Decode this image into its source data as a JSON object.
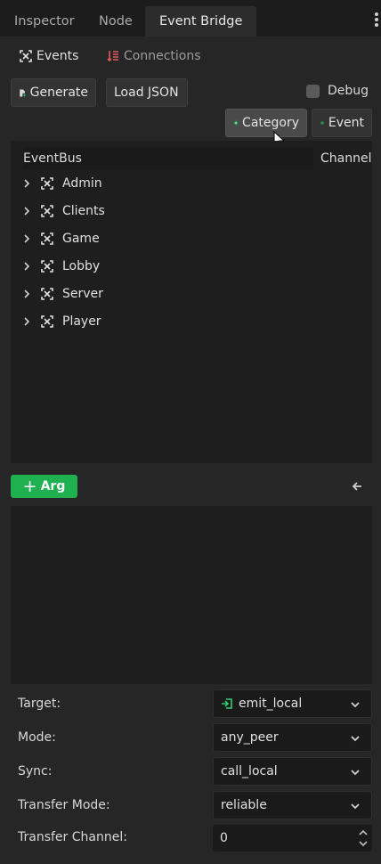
{
  "tabs": [
    {
      "label": "Inspector"
    },
    {
      "label": "Node"
    },
    {
      "label": "Event Bridge"
    }
  ],
  "subtabs": {
    "events": "Events",
    "connections": "Connections"
  },
  "toolbar": {
    "generate": "Generate",
    "load_json": "Load JSON",
    "debug": "Debug",
    "category": "Category",
    "event": "Event"
  },
  "tree": {
    "col_eventbus": "EventBus",
    "col_channel": "Channel",
    "items": [
      {
        "label": "Admin"
      },
      {
        "label": "Clients"
      },
      {
        "label": "Game"
      },
      {
        "label": "Lobby"
      },
      {
        "label": "Server"
      },
      {
        "label": "Player"
      }
    ]
  },
  "args": {
    "add_label": "Arg"
  },
  "props": {
    "target_label": "Target:",
    "target_value": "emit_local",
    "mode_label": "Mode:",
    "mode_value": "any_peer",
    "sync_label": "Sync:",
    "sync_value": "call_local",
    "transfer_mode_label": "Transfer Mode:",
    "transfer_mode_value": "reliable",
    "transfer_channel_label": "Transfer Channel:",
    "transfer_channel_value": "0"
  },
  "colors": {
    "accent_green": "#1fb14f",
    "connections_icon": "#e05a5a"
  },
  "icons": [
    "tree-expand-icon",
    "connections-icon",
    "generate-icon",
    "add-icon",
    "chevron-right-icon",
    "chevron-down-icon",
    "back-arrow-icon",
    "signal-icon",
    "kebab-icon"
  ]
}
